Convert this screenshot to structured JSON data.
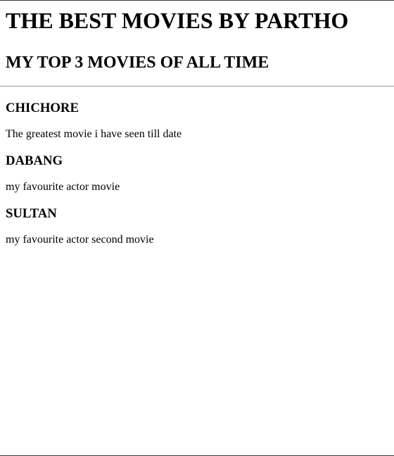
{
  "page": {
    "title": "THE BEST MOVIES BY PARTHO",
    "subtitle": "MY TOP 3 MOVIES OF ALL TIME"
  },
  "movies": [
    {
      "name": "CHICHORE",
      "description": "The greatest movie i have seen till date"
    },
    {
      "name": "DABANG",
      "description": "my favourite actor movie"
    },
    {
      "name": "SULTAN",
      "description": "my favourite actor second movie"
    }
  ]
}
